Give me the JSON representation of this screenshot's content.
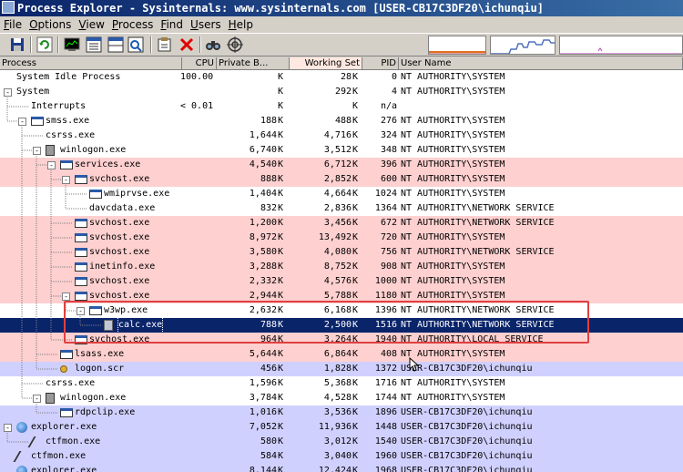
{
  "window": {
    "title": "Process Explorer - Sysinternals: www.sysinternals.com [USER-CB17C3DF20\\ichunqiu]"
  },
  "menu": [
    "File",
    "Options",
    "View",
    "Process",
    "Find",
    "Users",
    "Help"
  ],
  "toolbar": {
    "icons": [
      "save-icon",
      "refresh-icon",
      "system-info-icon",
      "process-tree-icon",
      "lower-pane-icon",
      "properties-icon",
      "find-window-icon",
      "kill-process-icon",
      "find-handle-icon",
      "target-icon"
    ]
  },
  "columns": {
    "process": "Process",
    "cpu": "CPU",
    "private_bytes": "Private B...",
    "working_set": "Working Set",
    "pid": "PID",
    "user_name": "User Name"
  },
  "colors": {
    "services": "#ffd0d0",
    "own_processes": "#d0d0ff",
    "selected": "#0a246a",
    "highlight_box": "#e04040"
  },
  "processes": [
    {
      "name": "System Idle Process",
      "depth": 0,
      "icon": "none",
      "cpu": "100.00",
      "private": "",
      "pk": "K",
      "ws": "28",
      "wk": "K",
      "pid": "0",
      "user": "NT AUTHORITY\\SYSTEM",
      "style": ""
    },
    {
      "name": "System",
      "depth": 0,
      "icon": "none",
      "cpu": "",
      "private": "",
      "pk": "K",
      "ws": "292",
      "wk": "K",
      "pid": "4",
      "user": "NT AUTHORITY\\SYSTEM",
      "style": "",
      "expander": "-"
    },
    {
      "name": "Interrupts",
      "depth": 1,
      "icon": "none",
      "cpu": "< 0.01",
      "private": "",
      "pk": "K",
      "ws": "",
      "wk": "K",
      "pid": "n/a",
      "user": "",
      "style": ""
    },
    {
      "name": "smss.exe",
      "depth": 1,
      "icon": "window",
      "cpu": "",
      "private": "188",
      "pk": "K",
      "ws": "488",
      "wk": "K",
      "pid": "276",
      "user": "NT AUTHORITY\\SYSTEM",
      "style": "",
      "expander": "-"
    },
    {
      "name": "csrss.exe",
      "depth": 2,
      "icon": "none",
      "cpu": "",
      "private": "1,644",
      "pk": "K",
      "ws": "4,716",
      "wk": "K",
      "pid": "324",
      "user": "NT AUTHORITY\\SYSTEM",
      "style": ""
    },
    {
      "name": "winlogon.exe",
      "depth": 2,
      "icon": "logon",
      "cpu": "",
      "private": "6,740",
      "pk": "K",
      "ws": "3,512",
      "wk": "K",
      "pid": "348",
      "user": "NT AUTHORITY\\SYSTEM",
      "style": "",
      "expander": "-"
    },
    {
      "name": "services.exe",
      "depth": 3,
      "icon": "window",
      "cpu": "",
      "private": "4,540",
      "pk": "K",
      "ws": "6,712",
      "wk": "K",
      "pid": "396",
      "user": "NT AUTHORITY\\SYSTEM",
      "style": "services",
      "expander": "-"
    },
    {
      "name": "svchost.exe",
      "depth": 4,
      "icon": "window",
      "cpu": "",
      "private": "888",
      "pk": "K",
      "ws": "2,852",
      "wk": "K",
      "pid": "600",
      "user": "NT AUTHORITY\\SYSTEM",
      "style": "services",
      "expander": "-"
    },
    {
      "name": "wmiprvse.exe",
      "depth": 5,
      "icon": "window",
      "cpu": "",
      "private": "1,404",
      "pk": "K",
      "ws": "4,664",
      "wk": "K",
      "pid": "1024",
      "user": "NT AUTHORITY\\SYSTEM",
      "style": ""
    },
    {
      "name": "davcdata.exe",
      "depth": 5,
      "icon": "none",
      "cpu": "",
      "private": "832",
      "pk": "K",
      "ws": "2,836",
      "wk": "K",
      "pid": "1364",
      "user": "NT AUTHORITY\\NETWORK SERVICE",
      "style": ""
    },
    {
      "name": "svchost.exe",
      "depth": 4,
      "icon": "window",
      "cpu": "",
      "private": "1,200",
      "pk": "K",
      "ws": "3,456",
      "wk": "K",
      "pid": "672",
      "user": "NT AUTHORITY\\NETWORK SERVICE",
      "style": "services"
    },
    {
      "name": "svchost.exe",
      "depth": 4,
      "icon": "window",
      "cpu": "",
      "private": "8,972",
      "pk": "K",
      "ws": "13,492",
      "wk": "K",
      "pid": "720",
      "user": "NT AUTHORITY\\SYSTEM",
      "style": "services"
    },
    {
      "name": "svchost.exe",
      "depth": 4,
      "icon": "window",
      "cpu": "",
      "private": "3,580",
      "pk": "K",
      "ws": "4,080",
      "wk": "K",
      "pid": "756",
      "user": "NT AUTHORITY\\NETWORK SERVICE",
      "style": "services"
    },
    {
      "name": "inetinfo.exe",
      "depth": 4,
      "icon": "window",
      "cpu": "",
      "private": "3,288",
      "pk": "K",
      "ws": "8,752",
      "wk": "K",
      "pid": "908",
      "user": "NT AUTHORITY\\SYSTEM",
      "style": "services"
    },
    {
      "name": "svchost.exe",
      "depth": 4,
      "icon": "window",
      "cpu": "",
      "private": "2,332",
      "pk": "K",
      "ws": "4,576",
      "wk": "K",
      "pid": "1000",
      "user": "NT AUTHORITY\\SYSTEM",
      "style": "services"
    },
    {
      "name": "svchost.exe",
      "depth": 4,
      "icon": "window",
      "cpu": "",
      "private": "2,944",
      "pk": "K",
      "ws": "5,788",
      "wk": "K",
      "pid": "1180",
      "user": "NT AUTHORITY\\SYSTEM",
      "style": "services",
      "expander": "-"
    },
    {
      "name": "w3wp.exe",
      "depth": 5,
      "icon": "window",
      "cpu": "",
      "private": "2,632",
      "pk": "K",
      "ws": "6,168",
      "wk": "K",
      "pid": "1396",
      "user": "NT AUTHORITY\\NETWORK SERVICE",
      "style": "",
      "expander": "-"
    },
    {
      "name": "calc.exe",
      "depth": 6,
      "icon": "calc",
      "cpu": "",
      "private": "788",
      "pk": "K",
      "ws": "2,500",
      "wk": "K",
      "pid": "1516",
      "user": "NT AUTHORITY\\NETWORK SERVICE",
      "style": "sel"
    },
    {
      "name": "svchost.exe",
      "depth": 4,
      "icon": "window",
      "cpu": "",
      "private": "964",
      "pk": "K",
      "ws": "3,264",
      "wk": "K",
      "pid": "1940",
      "user": "NT AUTHORITY\\LOCAL SERVICE",
      "style": "services"
    },
    {
      "name": "lsass.exe",
      "depth": 3,
      "icon": "window",
      "cpu": "",
      "private": "5,644",
      "pk": "K",
      "ws": "6,864",
      "wk": "K",
      "pid": "408",
      "user": "NT AUTHORITY\\SYSTEM",
      "style": "services"
    },
    {
      "name": "logon.scr",
      "depth": 3,
      "icon": "key",
      "cpu": "",
      "private": "456",
      "pk": "K",
      "ws": "1,828",
      "wk": "K",
      "pid": "1372",
      "user": "USER-CB17C3DF20\\ichunqiu",
      "style": "own"
    },
    {
      "name": "csrss.exe",
      "depth": 2,
      "icon": "none",
      "cpu": "",
      "private": "1,596",
      "pk": "K",
      "ws": "5,368",
      "wk": "K",
      "pid": "1716",
      "user": "NT AUTHORITY\\SYSTEM",
      "style": ""
    },
    {
      "name": "winlogon.exe",
      "depth": 2,
      "icon": "logon",
      "cpu": "",
      "private": "3,784",
      "pk": "K",
      "ws": "4,528",
      "wk": "K",
      "pid": "1744",
      "user": "NT AUTHORITY\\SYSTEM",
      "style": "",
      "expander": "-"
    },
    {
      "name": "rdpclip.exe",
      "depth": 3,
      "icon": "window",
      "cpu": "",
      "private": "1,016",
      "pk": "K",
      "ws": "3,536",
      "wk": "K",
      "pid": "1896",
      "user": "USER-CB17C3DF20\\ichunqiu",
      "style": "own"
    },
    {
      "name": "explorer.exe",
      "depth": 0,
      "icon": "ball",
      "cpu": "",
      "private": "7,052",
      "pk": "K",
      "ws": "11,936",
      "wk": "K",
      "pid": "1448",
      "user": "USER-CB17C3DF20\\ichunqiu",
      "style": "own",
      "expander": "-"
    },
    {
      "name": "ctfmon.exe",
      "depth": 1,
      "icon": "pen",
      "cpu": "",
      "private": "580",
      "pk": "K",
      "ws": "3,012",
      "wk": "K",
      "pid": "1540",
      "user": "USER-CB17C3DF20\\ichunqiu",
      "style": "own"
    },
    {
      "name": "ctfmon.exe",
      "depth": 0,
      "icon": "pen",
      "cpu": "",
      "private": "584",
      "pk": "K",
      "ws": "3,040",
      "wk": "K",
      "pid": "1960",
      "user": "USER-CB17C3DF20\\ichunqiu",
      "style": "own"
    },
    {
      "name": "explorer.exe",
      "depth": 0,
      "icon": "ball",
      "cpu": "",
      "private": "8,144",
      "pk": "K",
      "ws": "12,424",
      "wk": "K",
      "pid": "1968",
      "user": "USER-CB17C3DF20\\ichunqiu",
      "style": "own"
    }
  ]
}
